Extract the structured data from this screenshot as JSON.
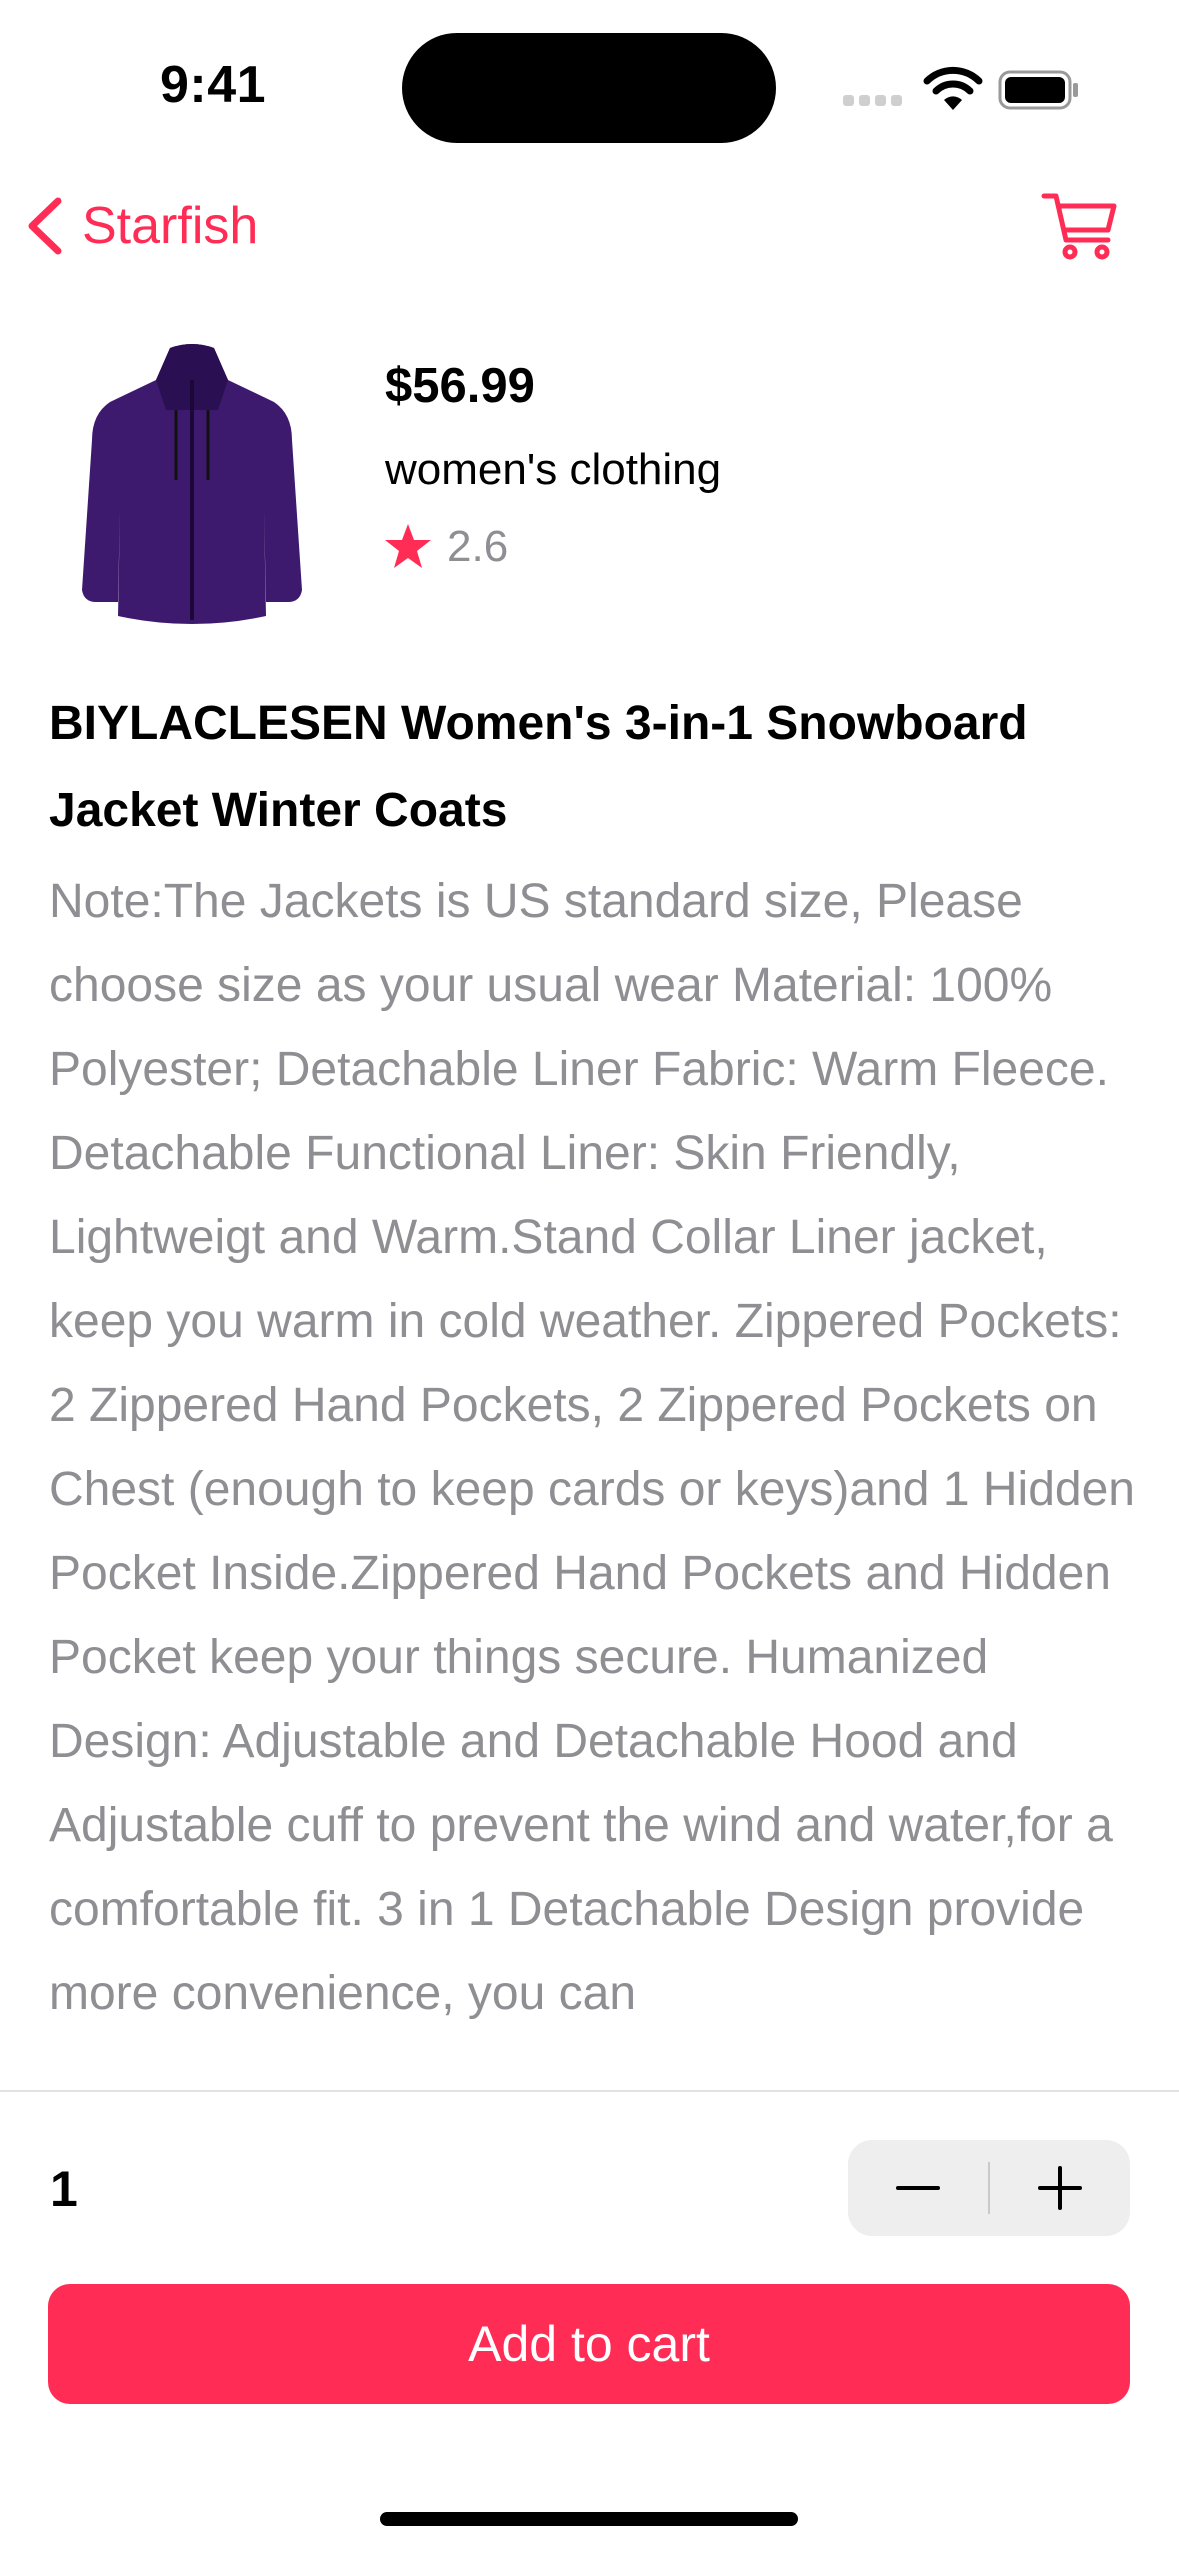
{
  "status_bar": {
    "time": "9:41"
  },
  "nav": {
    "back_label": "Starfish",
    "back_icon": "chevron-left-icon",
    "cart_icon": "cart-icon"
  },
  "product": {
    "image_icon": "jacket-image",
    "price": "$56.99",
    "category": "women's clothing",
    "rating": "2.6",
    "title": "BIYLACLESEN Women's 3-in-1 Snowboard Jacket Winter Coats",
    "description": "Note:The Jackets is US standard size, Please choose size as your usual wear Material: 100% Polyester; Detachable Liner Fabric: Warm Fleece. Detachable Functional Liner: Skin Friendly, Lightweigt and Warm.Stand Collar Liner jacket, keep you warm in cold weather. Zippered Pockets: 2 Zippered Hand Pockets, 2 Zippered Pockets on Chest (enough to keep cards or keys)and 1 Hidden Pocket Inside.Zippered Hand Pockets and Hidden Pocket keep your things secure. Humanized Design: Adjustable and Detachable Hood and Adjustable cuff to prevent the wind and water,for a comfortable fit. 3 in 1 Detachable Design provide more convenience, you can"
  },
  "cart_controls": {
    "quantity": "1",
    "add_label": "Add to cart"
  },
  "colors": {
    "accent": "#ff2d55",
    "secondary_text": "#8e8e93",
    "stepper_bg": "#eeeeef"
  }
}
